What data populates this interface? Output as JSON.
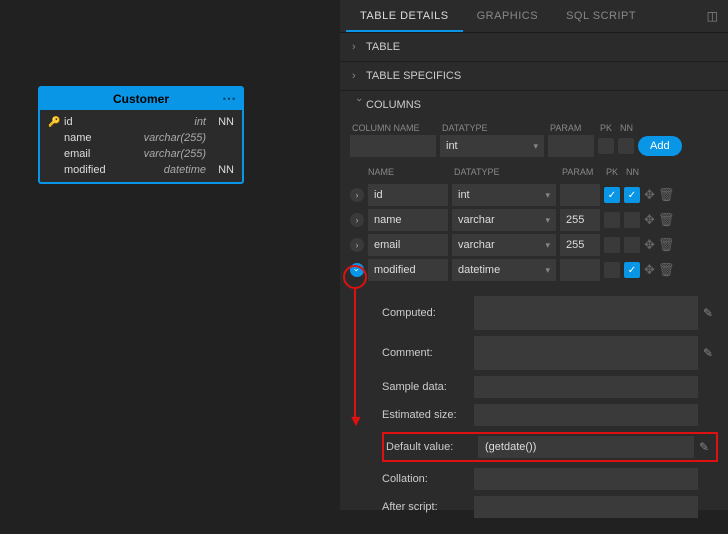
{
  "canvas": {
    "entity": {
      "title": "Customer",
      "rows": [
        {
          "key": true,
          "name": "id",
          "type": "int",
          "nn": "NN"
        },
        {
          "key": false,
          "name": "name",
          "type": "varchar(255)",
          "nn": ""
        },
        {
          "key": false,
          "name": "email",
          "type": "varchar(255)",
          "nn": ""
        },
        {
          "key": false,
          "name": "modified",
          "type": "datetime",
          "nn": "NN"
        }
      ]
    }
  },
  "tabs": {
    "items": [
      "TABLE DETAILS",
      "GRAPHICS",
      "SQL SCRIPT"
    ],
    "active": 0
  },
  "sections": {
    "table": "TABLE",
    "specifics": "TABLE SPECIFICS",
    "columns": "COLUMNS"
  },
  "newcol": {
    "headers": {
      "name": "COLUMN NAME",
      "datatype": "DATATYPE",
      "param": "PARAM",
      "pk": "PK",
      "nn": "NN"
    },
    "datatype": "int",
    "add": "Add"
  },
  "collist": {
    "headers": {
      "name": "NAME",
      "datatype": "DATATYPE",
      "param": "PARAM",
      "pk": "PK",
      "nn": "NN"
    },
    "rows": [
      {
        "name": "id",
        "datatype": "int",
        "param": "",
        "pk": true,
        "nn": true,
        "open": false
      },
      {
        "name": "name",
        "datatype": "varchar",
        "param": "255",
        "pk": false,
        "nn": false,
        "open": false
      },
      {
        "name": "email",
        "datatype": "varchar",
        "param": "255",
        "pk": false,
        "nn": false,
        "open": false
      },
      {
        "name": "modified",
        "datatype": "datetime",
        "param": "",
        "pk": false,
        "nn": true,
        "open": true
      }
    ]
  },
  "details": {
    "computed": {
      "label": "Computed:",
      "value": ""
    },
    "comment": {
      "label": "Comment:",
      "value": ""
    },
    "sample": {
      "label": "Sample data:",
      "value": ""
    },
    "estsize": {
      "label": "Estimated size:",
      "value": ""
    },
    "default": {
      "label": "Default value:",
      "value": "(getdate())"
    },
    "collation": {
      "label": "Collation:",
      "value": ""
    },
    "after": {
      "label": "After script:",
      "value": ""
    }
  }
}
